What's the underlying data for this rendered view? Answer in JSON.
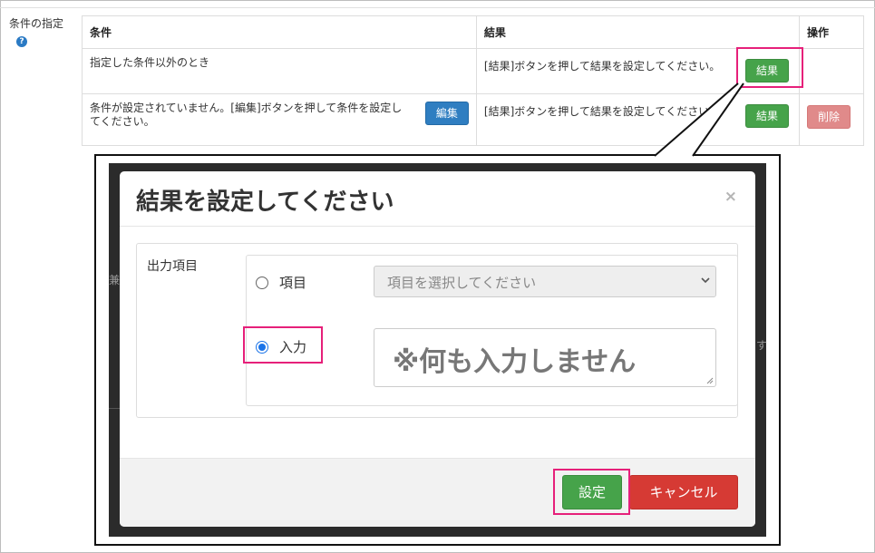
{
  "side_label": {
    "text": "条件の指定",
    "help_icon": "question-circle-icon"
  },
  "table": {
    "headers": [
      "条件",
      "結果",
      "操作"
    ],
    "rows": [
      {
        "condition": "指定した条件以外のとき",
        "result": "[結果]ボタンを押して結果を設定してください。",
        "result_button": "結果"
      },
      {
        "condition": "条件が設定されていません。[編集]ボタンを押して条件を設定してください。",
        "edit_button": "編集",
        "result": "[結果]ボタンを押して結果を設定してください。",
        "result_button": "結果",
        "delete_button": "削除"
      }
    ]
  },
  "modal": {
    "title": "結果を設定してください",
    "close": "×",
    "field_label": "出力項目",
    "option_item": {
      "label": "項目",
      "checked": false
    },
    "option_input": {
      "label": "入力",
      "checked": true
    },
    "select_placeholder": "項目を選択してください",
    "input_value": "※何も入力しません",
    "set_button": "設定",
    "cancel_button": "キャンセル"
  },
  "colors": {
    "highlight": "#e6207a",
    "green": "#46a34a",
    "blue": "#2f7ec1",
    "red": "#d63a34"
  }
}
